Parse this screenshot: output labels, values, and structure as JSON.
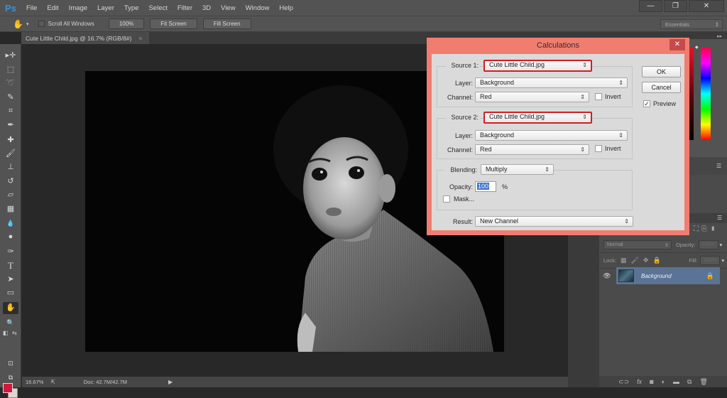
{
  "app": {
    "logo": "Ps",
    "menu": [
      "File",
      "Edit",
      "Image",
      "Layer",
      "Type",
      "Select",
      "Filter",
      "3D",
      "View",
      "Window",
      "Help"
    ],
    "window_controls": {
      "minimize": "—",
      "restore": "❐",
      "close": "✕"
    }
  },
  "options_bar": {
    "tool_icon": "hand-icon",
    "scroll_all_windows_label": "Scroll All Windows",
    "scroll_all_windows_checked": false,
    "zoom_100_label": "100%",
    "fit_screen_label": "Fit Screen",
    "fill_screen_label": "Fill Screen",
    "workspace": "Essentials"
  },
  "document": {
    "tab_title": "Cute Little Child.jpg @ 16.7% (RGB/8#)",
    "tab_close": "×"
  },
  "tools": [
    {
      "name": "move",
      "glyph": "▸✛"
    },
    {
      "name": "marquee",
      "glyph": "⬚"
    },
    {
      "name": "lasso",
      "glyph": "➰"
    },
    {
      "name": "quick-select",
      "glyph": "✎"
    },
    {
      "name": "crop",
      "glyph": "⌗"
    },
    {
      "name": "eyedropper",
      "glyph": "✒"
    },
    {
      "name": "healing-brush",
      "glyph": "✚"
    },
    {
      "name": "brush",
      "glyph": "🖌"
    },
    {
      "name": "clone-stamp",
      "glyph": "⊥"
    },
    {
      "name": "history-brush",
      "glyph": "↺"
    },
    {
      "name": "eraser",
      "glyph": "▱"
    },
    {
      "name": "gradient",
      "glyph": "▦"
    },
    {
      "name": "blur",
      "glyph": "💧"
    },
    {
      "name": "dodge",
      "glyph": "●"
    },
    {
      "name": "pen",
      "glyph": "✑"
    },
    {
      "name": "type",
      "glyph": "T"
    },
    {
      "name": "path-selection",
      "glyph": "➤"
    },
    {
      "name": "rectangle",
      "glyph": "▭"
    },
    {
      "name": "hand",
      "glyph": "✋"
    },
    {
      "name": "zoom",
      "glyph": "🔍"
    }
  ],
  "colors": {
    "foreground": "#d4163c",
    "background": "#ddd6cc",
    "dialog_frame": "#f07d70",
    "highlight_border": "#d31d24",
    "layer_selected": "#5b7394"
  },
  "status_bar": {
    "zoom": "16.67%",
    "doc_size": "Doc: 42.7M/42.7M"
  },
  "layers_panel": {
    "blend_mode": "Normal",
    "opacity_label": "Opacity:",
    "opacity_value": "100%",
    "lock_label": "Lock:",
    "fill_label": "Fill:",
    "fill_value": "100%",
    "layers": [
      {
        "name": "Background",
        "visible": true,
        "locked": true,
        "selected": true
      }
    ],
    "footer_icons": [
      "link-icon",
      "fx-icon",
      "mask-icon",
      "adjustment-icon",
      "folder-icon",
      "new-layer-icon",
      "trash-icon"
    ]
  },
  "dialog": {
    "title": "Calculations",
    "close": "✕",
    "source1": {
      "label": "Source 1:",
      "file": "Cute Little Child.jpg",
      "layer_label": "Layer:",
      "layer": "Background",
      "channel_label": "Channel:",
      "channel": "Red",
      "invert_label": "Invert",
      "invert": false
    },
    "source2": {
      "label": "Source 2:",
      "file": "Cute Little Child.jpg",
      "layer_label": "Layer:",
      "layer": "Background",
      "channel_label": "Channel:",
      "channel": "Red",
      "invert_label": "Invert",
      "invert": false
    },
    "blending": {
      "label": "Blending:",
      "mode": "Multiply",
      "opacity_label": "Opacity:",
      "opacity": "100",
      "percent": "%",
      "mask_label": "Mask...",
      "mask": false
    },
    "result": {
      "label": "Result:",
      "value": "New Channel"
    },
    "ok_label": "OK",
    "cancel_label": "Cancel",
    "preview_label": "Preview",
    "preview": true
  }
}
